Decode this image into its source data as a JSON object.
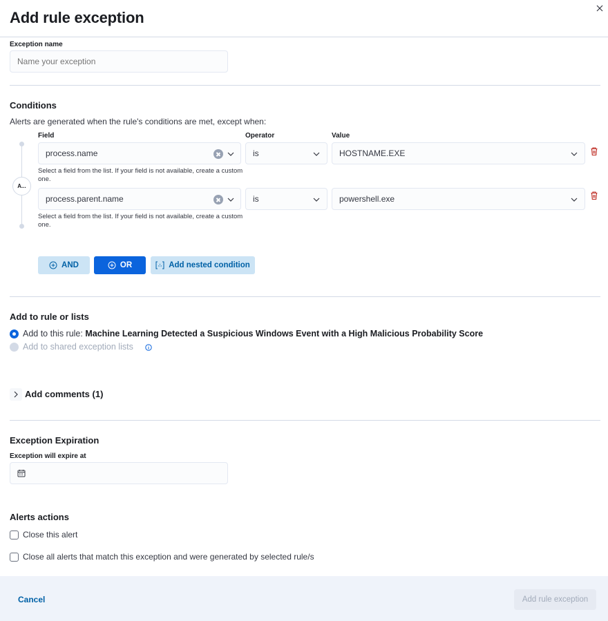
{
  "header": {
    "title": "Add rule exception",
    "close_icon": "close-icon"
  },
  "exception_name": {
    "label": "Exception name",
    "placeholder": "Name your exception",
    "value": ""
  },
  "conditions": {
    "title": "Conditions",
    "description": "Alerts are generated when the rule's conditions are met, except when:",
    "column_labels": {
      "field": "Field",
      "operator": "Operator",
      "value": "Value"
    },
    "group_badge": "A...",
    "entries": [
      {
        "field": "process.name",
        "operator": "is",
        "value": "HOSTNAME.EXE",
        "help": "Select a field from the list. If your field is not available, create a custom one."
      },
      {
        "field": "process.parent.name",
        "operator": "is",
        "value": "powershell.exe",
        "help": "Select a field from the list. If your field is not available, create a custom one."
      }
    ],
    "buttons": {
      "and": "AND",
      "or": "OR",
      "nested": "Add nested condition"
    }
  },
  "add_to": {
    "title": "Add to rule or lists",
    "options": [
      {
        "prefix": "Add to this rule: ",
        "rule_name": "Machine Learning Detected a Suspicious Windows Event with a High Malicious Probability Score",
        "selected": true,
        "disabled": false
      },
      {
        "prefix": "Add to shared exception lists",
        "selected": false,
        "disabled": true
      }
    ]
  },
  "comments": {
    "label": "Add comments (1)"
  },
  "expiration": {
    "title": "Exception Expiration",
    "label": "Exception will expire at",
    "value": ""
  },
  "alerts_actions": {
    "title": "Alerts actions",
    "options": [
      {
        "label": "Close this alert",
        "checked": false
      },
      {
        "label": "Close all alerts that match this exception and were generated by selected rule/s",
        "checked": false
      }
    ]
  },
  "footer": {
    "cancel": "Cancel",
    "submit": "Add rule exception"
  },
  "colors": {
    "primary": "#0b64dd",
    "link": "#0061a6",
    "danger": "#bd271e",
    "footer_bg": "#eff3fa"
  }
}
